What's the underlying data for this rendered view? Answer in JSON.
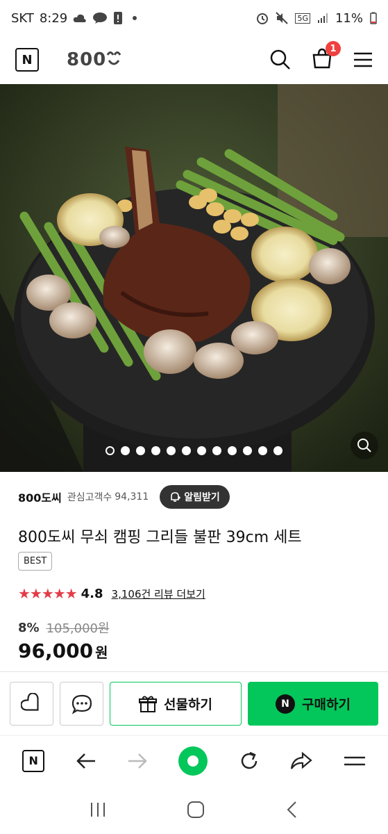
{
  "status_bar": {
    "carrier": "SKT",
    "time": "8:29",
    "network": "5G",
    "battery": "11%"
  },
  "header": {
    "brand_logo": "800",
    "cart_count": "1"
  },
  "gallery": {
    "dot_count": 12,
    "active_index": 0
  },
  "product": {
    "seller": "800도씨",
    "watchers_label": "관심고객수",
    "watchers_count": "94,311",
    "alert_button": "알림받기",
    "title": "800도씨 무쇠 캠핑 그리들 불판 39cm 세트",
    "best_badge": "BEST",
    "rating": "4.8",
    "stars": "★★★★★",
    "reviews_link": "3,106건 리뷰 더보기",
    "discount": "8%",
    "original_price": "105,000원",
    "price": "96,000",
    "currency": "원"
  },
  "actions": {
    "gift_button": "선물하기",
    "buy_button": "구매하기",
    "buy_icon_letter": "N"
  },
  "colors": {
    "accent_green": "#03c75a",
    "star_red": "#e33b48",
    "badge_red": "#f04040"
  }
}
